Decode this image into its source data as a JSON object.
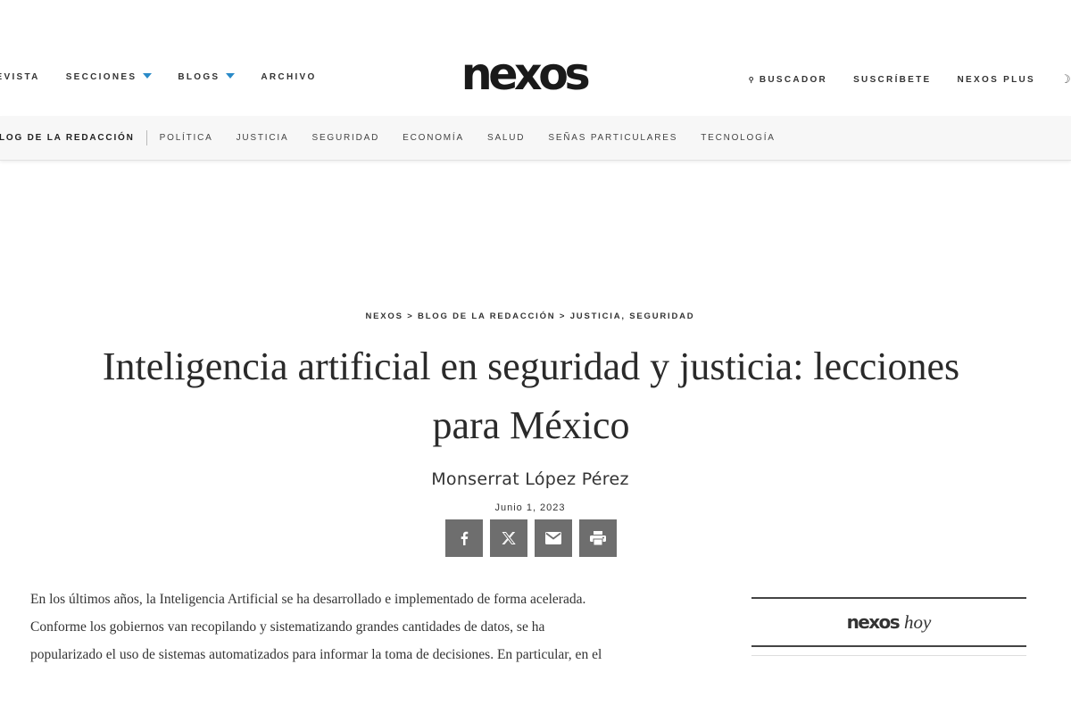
{
  "header": {
    "nav_left": [
      {
        "label": "REVISTA"
      },
      {
        "label": "SECCIONES",
        "has_dropdown": true
      },
      {
        "label": "BLOGS",
        "has_dropdown": true
      },
      {
        "label": "ARCHIVO"
      }
    ],
    "logo": "nexos",
    "nav_right": [
      {
        "label": "BUSCADOR",
        "icon": "search-icon"
      },
      {
        "label": "SUSCRÍBETE"
      },
      {
        "label": "NEXOS PLUS"
      }
    ],
    "theme_icon": "moon-icon",
    "accent_color": "#2a8ac8"
  },
  "subnav": {
    "active": "BLOG DE LA REDACCIÓN",
    "items": [
      "POLÍTICA",
      "JUSTICIA",
      "SEGURIDAD",
      "ECONOMÍA",
      "SALUD",
      "SEÑAS PARTICULARES",
      "TECNOLOGÍA"
    ]
  },
  "article": {
    "breadcrumb": {
      "items": [
        "NEXOS",
        "BLOG DE LA REDACCIÓN",
        "JUSTICIA, SEGURIDAD"
      ],
      "separator": ">"
    },
    "title": "Inteligencia artificial en seguridad y justicia: lecciones para México",
    "author": "Monserrat López Pérez",
    "date": "Junio 1, 2023",
    "share_buttons": [
      "facebook-icon",
      "x-icon",
      "email-icon",
      "print-icon"
    ],
    "body_lines": [
      "En los últimos años, la Inteligencia Artificial se ha desarrollado e implementado de forma acelerada.",
      "Conforme los gobiernos van recopilando y sistematizando grandes cantidades de datos, se ha",
      "popularizado el uso de sistemas automatizados para informar la toma de decisiones. En particular, en el"
    ]
  },
  "sidebar": {
    "logo": "nexos",
    "title_suffix": "hoy"
  }
}
